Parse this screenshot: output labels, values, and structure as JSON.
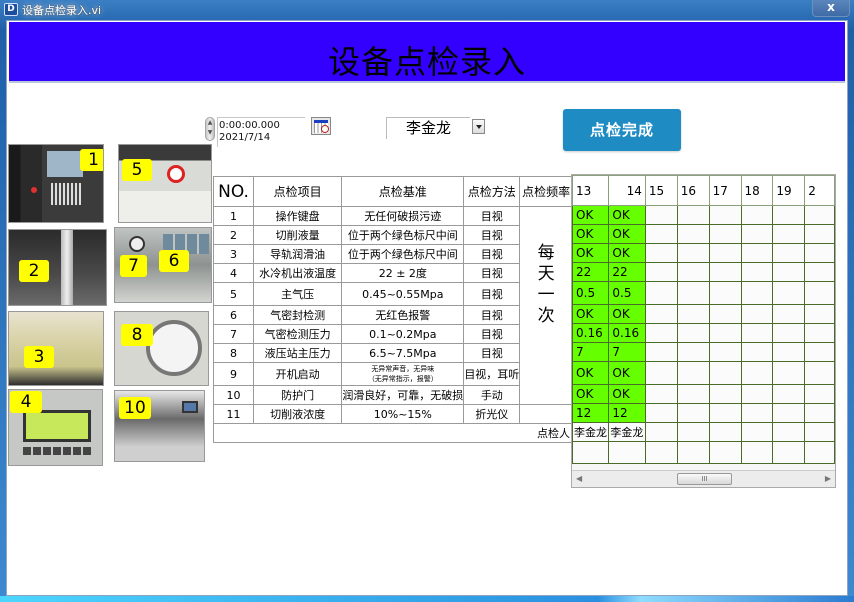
{
  "window": {
    "title": "设备点检录入.vi",
    "close_label": "x",
    "app_icon": "labview-icon"
  },
  "banner": {
    "title": "设备点检录入",
    "color": "#3300ff"
  },
  "datetime": {
    "time": "0:00:00.000",
    "date": "2021/7/14"
  },
  "inspector": {
    "selected": "李金龙"
  },
  "done_button": {
    "label": "点检完成",
    "color": "#1e8bc3"
  },
  "photos": [
    {
      "tag": "1",
      "subject": "operation-keyboard"
    },
    {
      "tag": "2",
      "subject": "coolant-level-gauge"
    },
    {
      "tag": "3",
      "subject": "lubrication-oil-tank"
    },
    {
      "tag": "4",
      "subject": "chiller-display"
    },
    {
      "tag": "5",
      "subject": "main-air-pressure-gauge"
    },
    {
      "tag": "7",
      "subject": "air-tight-pressure-gauge"
    },
    {
      "tag": "6",
      "subject": "air-seal-indicators"
    },
    {
      "tag": "8",
      "subject": "hydraulic-pressure-gauge"
    },
    {
      "tag": "10",
      "subject": "protective-door"
    }
  ],
  "table": {
    "headers": [
      "NO.",
      "点检项目",
      "点检基准",
      "点检方法",
      "点检频率"
    ],
    "frequency": [
      "每",
      "天",
      "一",
      "次"
    ],
    "rows": [
      {
        "no": "1",
        "item": "操作键盘",
        "standard": "无任何破损污迹",
        "method": "目视"
      },
      {
        "no": "2",
        "item": "切削液量",
        "standard": "位于两个绿色标尺中间",
        "method": "目视"
      },
      {
        "no": "3",
        "item": "导轨润滑油",
        "standard": "位于两个绿色标尺中间",
        "method": "目视"
      },
      {
        "no": "4",
        "item": "水冷机出液温度",
        "standard": "22 ± 2度",
        "method": "目视"
      },
      {
        "no": "5",
        "item": "主气压",
        "standard": "0.45~0.55Mpa",
        "method": "目视"
      },
      {
        "no": "6",
        "item": "气密封检测",
        "standard": "无红色报警",
        "method": "目视"
      },
      {
        "no": "7",
        "item": "气密检测压力",
        "standard": "0.1~0.2Mpa",
        "method": "目视"
      },
      {
        "no": "8",
        "item": "液压站主压力",
        "standard": "6.5~7.5Mpa",
        "method": "目视"
      },
      {
        "no": "9",
        "item": "开机启动",
        "standard_line1": "无异常声音，无异味",
        "standard_line2": "（无异常指示，报警）",
        "method": "目视，耳听"
      },
      {
        "no": "10",
        "item": "防护门",
        "standard": "润滑良好，可靠，无破损",
        "method": "手动"
      },
      {
        "no": "11",
        "item": "切削液浓度",
        "standard": "10%~15%",
        "method": "折光仪"
      }
    ],
    "inspector_label": "点检人"
  },
  "grid": {
    "day_headers": [
      "13",
      "14",
      "15",
      "16",
      "17",
      "18",
      "19",
      "2"
    ],
    "ok_color": "#66ff00",
    "values": [
      [
        "OK",
        "OK"
      ],
      [
        "OK",
        "OK"
      ],
      [
        "OK",
        "OK"
      ],
      [
        "22",
        "22"
      ],
      [
        "0.5",
        "0.5"
      ],
      [
        "OK",
        "OK"
      ],
      [
        "0.16",
        "0.16"
      ],
      [
        "7",
        "7"
      ],
      [
        "OK",
        "OK"
      ],
      [
        "OK",
        "OK"
      ],
      [
        "12",
        "12"
      ]
    ],
    "inspectors": [
      "李金龙",
      "李金龙"
    ],
    "scroll_thumb": "III"
  }
}
